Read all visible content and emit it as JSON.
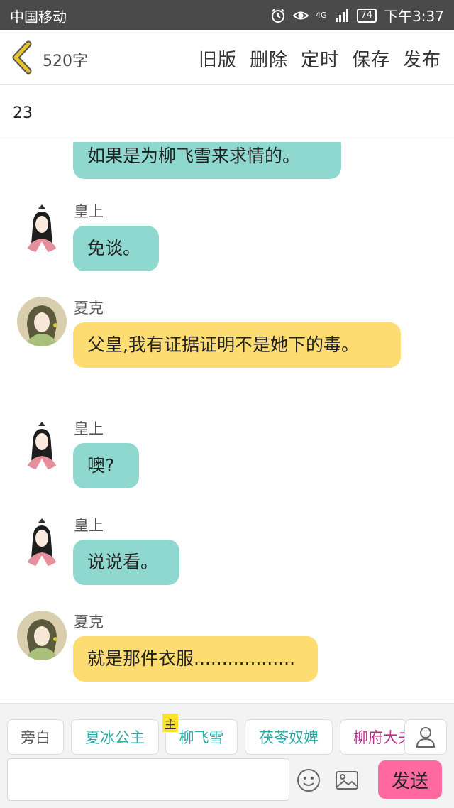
{
  "status_bar": {
    "carrier": "中国移动",
    "battery": "74",
    "network": "4G",
    "time": "下午3:37"
  },
  "top_bar": {
    "word_count": "520字",
    "actions": {
      "old_version": "旧版",
      "delete": "删除",
      "schedule": "定时",
      "save": "保存",
      "publish": "发布"
    }
  },
  "title": "23",
  "messages": [
    {
      "speaker": "",
      "text": "如果是为柳飞雪来求情的。",
      "color": "teal"
    },
    {
      "speaker": "皇上",
      "text": "免谈。",
      "color": "teal"
    },
    {
      "speaker": "夏克",
      "text": "父皇,我有证据证明不是她下的毒。",
      "color": "yellow"
    },
    {
      "speaker": "皇上",
      "text": "噢?",
      "color": "teal"
    },
    {
      "speaker": "皇上",
      "text": "说说看。",
      "color": "teal"
    },
    {
      "speaker": "夏克",
      "text": "就是那件衣服..................",
      "color": "yellow"
    }
  ],
  "characters": {
    "narration": "旁白",
    "c1": "夏冰公主",
    "c2": "柳飞雪",
    "c3": "茯苓奴婢",
    "c4": "柳府大夫",
    "main_badge": "主"
  },
  "composer": {
    "input_value": "",
    "send_label": "发送"
  },
  "colors": {
    "teal_bubble": "#8ed8d0",
    "yellow_bubble": "#fddc71",
    "send_button": "#ff69a0",
    "back_icon": "#e8c22a"
  }
}
